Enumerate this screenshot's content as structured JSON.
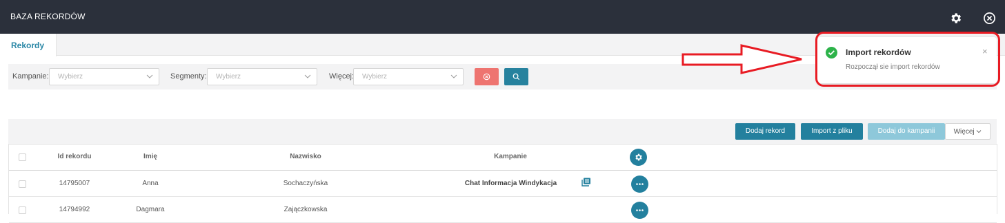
{
  "header": {
    "title": "BAZA REKORDÓW",
    "settings_icon": "gear-icon",
    "close_icon": "close-circle-icon"
  },
  "tabs": [
    {
      "label": "Rekordy",
      "active": true
    }
  ],
  "filters": {
    "campaign": {
      "label": "Kampanie:",
      "placeholder": "Wybierz"
    },
    "segment": {
      "label": "Segmenty:",
      "placeholder": "Wybierz"
    },
    "more": {
      "label": "Więcej:",
      "placeholder": "Wybierz"
    },
    "clear_icon": "clear-icon",
    "search_icon": "search-icon"
  },
  "toolbar": {
    "add_record": "Dodaj rekord",
    "import_file": "Import z pliku",
    "add_to_campaign": "Dodaj do kampanii",
    "more": "Więcej"
  },
  "table": {
    "columns": [
      "Id rekordu",
      "Imię",
      "Nazwisko",
      "Kampanie"
    ],
    "rows": [
      {
        "id": "14795007",
        "first_name": "Anna",
        "last_name": "Sochaczyńska",
        "campaign": "Chat Informacja Windykacja"
      },
      {
        "id": "14794992",
        "first_name": "Dagmara",
        "last_name": "Zajączkowska",
        "campaign": ""
      }
    ]
  },
  "toast": {
    "title": "Import rekordów",
    "message": "Rozpoczął sie import rekordów",
    "close": "×"
  },
  "colors": {
    "header_bg": "#2b303b",
    "primary": "#23809e",
    "danger": "#ee7470",
    "disabled": "#8ec8da",
    "annotation": "#e81b23",
    "success": "#2db34a"
  }
}
